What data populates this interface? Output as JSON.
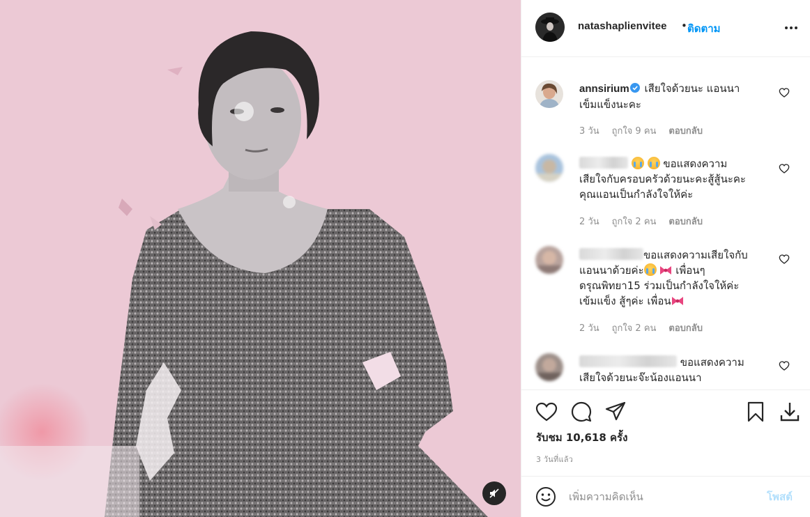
{
  "header": {
    "username": "natashaplienvitee",
    "separator": "•",
    "follow_label": "ติดตาม",
    "more_icon": "more-horizontal-icon"
  },
  "comments": [
    {
      "name": "annsirium",
      "verified": true,
      "line1": "เสียใจด้วยนะ แอนนา",
      "line2": "เข็มแข็งนะคะ",
      "time": "3 วัน",
      "likes": "ถูกใจ 9 คน",
      "reply": "ตอบกลับ"
    },
    {
      "name_hidden": true,
      "line1": "ขอแสดงความ",
      "line2": "เสียใจกับครอบครัวด้วยนะคะสู้สู้นะคะ",
      "line3": "คุณแอนเป็นกำลังใจให้ค่ะ",
      "time": "2 วัน",
      "likes": "ถูกใจ 2 คน",
      "reply": "ตอบกลับ"
    },
    {
      "name_hidden": true,
      "line1": "ขอแสดงความเสียใจกับ",
      "line2a": "แอนนาด้วยค่ะ",
      "line2b": "เพื่อนๆ",
      "line3": "ดรุณพิทยา15 ร่วมเป็นกำลังใจให้ค่ะ",
      "line4": "เข้มแข็ง สู้ๆค่ะ เพื่อน",
      "time": "2 วัน",
      "likes": "ถูกใจ 2 คน",
      "reply": "ตอบกลับ"
    },
    {
      "name_hidden": true,
      "line1": "ขอแสดงความ",
      "line2": "เสียใจด้วยนะจ๊ะน้องแอนนา"
    }
  ],
  "actions": {
    "views": "รับชม 10,618 ครั้ง",
    "posted": "3 วันที่แล้ว"
  },
  "composer": {
    "placeholder": "เพิ่มความคิดเห็น",
    "post_label": "โพสต์"
  },
  "colors": {
    "accent": "#0095f6",
    "media_bg": "#eccad6",
    "muted": "#8e8e8e"
  }
}
